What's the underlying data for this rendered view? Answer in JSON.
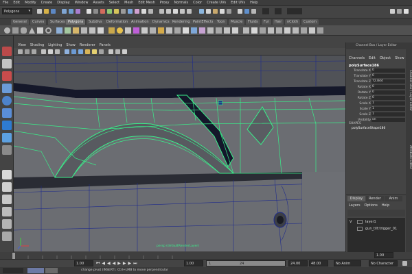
{
  "menubar": {
    "items": [
      "File",
      "Edit",
      "Modify",
      "Create",
      "Display",
      "Window",
      "Assets",
      "Select",
      "Mesh",
      "Edit Mesh",
      "Proxy",
      "Normals",
      "Color",
      "Create UVs",
      "Edit UVs",
      "Help"
    ]
  },
  "statusline": {
    "mode": "Polygons"
  },
  "shelf": {
    "tabs": [
      "General",
      "Curves",
      "Surfaces",
      "Polygons",
      "Subdivs",
      "Deformation",
      "Animation",
      "Dynamics",
      "Rendering",
      "PaintEffects",
      "Toon",
      "Muscle",
      "Fluids",
      "Fur",
      "Hair",
      "nCloth",
      "Custom"
    ],
    "active_tab": "Polygons"
  },
  "viewport": {
    "menu": [
      "View",
      "Shading",
      "Lighting",
      "Show",
      "Renderer",
      "Panels"
    ],
    "camera_label": "persp (defaultRenderLayer)",
    "colors": {
      "bg": "#6d6f74",
      "wire": "#1e2a8c",
      "select_wire": "#39f08a"
    }
  },
  "channelbox": {
    "title": "Channel Box / Layer Editor",
    "menu": [
      "Channels",
      "Edit",
      "Object",
      "Show"
    ],
    "object_name": "polySurface186",
    "attributes": [
      {
        "name": "Translate X",
        "value": "0"
      },
      {
        "name": "Translate Y",
        "value": "0"
      },
      {
        "name": "Translate Z",
        "value": "72.844"
      },
      {
        "name": "Rotate X",
        "value": "0"
      },
      {
        "name": "Rotate Y",
        "value": "0"
      },
      {
        "name": "Rotate Z",
        "value": "0"
      },
      {
        "name": "Scale X",
        "value": "1"
      },
      {
        "name": "Scale Y",
        "value": "1"
      },
      {
        "name": "Scale Z",
        "value": "1"
      },
      {
        "name": "Visibility",
        "value": "on"
      }
    ],
    "shapes_label": "SHAPES",
    "shape_name": "polySurfaceShape186",
    "side_label": "Channel Box / Layer Editor",
    "side_label2": "Attribute Editor"
  },
  "layers": {
    "tabs": [
      "Display",
      "Render",
      "Anim"
    ],
    "menu": [
      "Layers",
      "Options",
      "Help"
    ],
    "items": [
      {
        "visible": "V",
        "name": "layer1"
      },
      {
        "visible": "",
        "name": "gun_tilt:trigger_01"
      }
    ]
  },
  "timeslider": {
    "ticks": [
      "2",
      "4",
      "6",
      "8",
      "10",
      "12",
      "14",
      "16",
      "18",
      "20",
      "22",
      "24"
    ],
    "current_frame": "1.00"
  },
  "rangebar": {
    "start": "1.00",
    "range_start_field": "1.00",
    "range_inner_start": "1",
    "range_inner_end": "24",
    "range_end": "24.00",
    "anim_end": "48.00",
    "anim_layer": "No Anim Layer",
    "char_set": "No Character Set"
  },
  "helpline": {
    "text": "change pivot (INSERT). Ctrl+LMB to move perpendicular"
  }
}
